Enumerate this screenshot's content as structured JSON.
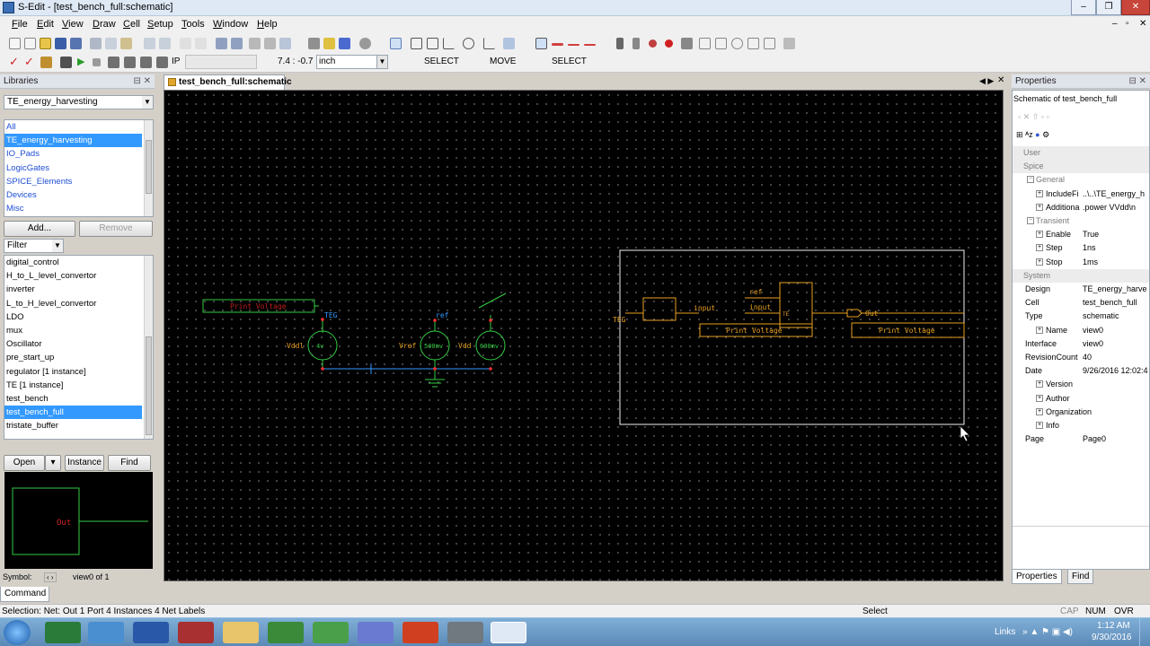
{
  "window": {
    "title": "S-Edit - [test_bench_full:schematic]"
  },
  "menu": [
    "File",
    "Edit",
    "View",
    "Draw",
    "Cell",
    "Setup",
    "Tools",
    "Window",
    "Help"
  ],
  "menu_underline": [
    "F",
    "E",
    "V",
    "D",
    "C",
    "S",
    "T",
    "W",
    "H"
  ],
  "toolbar": {
    "coord": "7.4 : -0.7",
    "unit": "inch",
    "mode_buttons": [
      "SELECT",
      "MOVE",
      "SELECT"
    ]
  },
  "libraries": {
    "header": "Libraries",
    "selected_library": "TE_energy_harvesting",
    "library_list": [
      "All",
      "TE_energy_harvesting",
      "IO_Pads",
      "LogicGates",
      "SPICE_Elements",
      "Devices",
      "Misc"
    ],
    "add_label": "Add...",
    "remove_label": "Remove",
    "filter_label": "Filter",
    "cells": [
      "digital_control",
      "H_to_L_level_convertor",
      "inverter",
      "L_to_H_level_convertor",
      "LDO",
      "mux",
      "Oscillator",
      "pre_start_up",
      "regulator [1 instance]",
      "TE [1 instance]",
      "test_bench",
      "test_bench_full",
      "tristate_buffer"
    ],
    "selected_cell": "test_bench_full",
    "open_label": "Open",
    "instance_label": "Instance",
    "find_label": "Find",
    "preview_label": "Out",
    "symbol_label": "Symbol:",
    "view_label": "view0 of 1"
  },
  "document_tab": "test_bench_full:schematic",
  "schematic": {
    "labels": {
      "print_voltage": "Print Voltage",
      "teg": "TEG",
      "ref": "ref",
      "vddl": "Vddl",
      "v4": "4v",
      "vref": "Vref",
      "v500": "500mv",
      "vdd": "Vdd",
      "v600": "600mv",
      "input": "input",
      "out": "Out",
      "te": "TE"
    }
  },
  "properties": {
    "header": "Properties",
    "title": "Schematic of test_bench_full",
    "rows": [
      {
        "key": "User",
        "value": "",
        "type": "cat"
      },
      {
        "key": "Spice",
        "value": "",
        "type": "cat"
      },
      {
        "key": "General",
        "value": "",
        "type": "sub"
      },
      {
        "key": "IncludeFi",
        "value": "..\\..\\TE_energy_h",
        "type": "item"
      },
      {
        "key": "Additiona",
        "value": ".power VVdd\\n",
        "type": "item"
      },
      {
        "key": "Transient",
        "value": "",
        "type": "sub"
      },
      {
        "key": "Enable",
        "value": "True",
        "type": "item"
      },
      {
        "key": "Step",
        "value": "1ns",
        "type": "item"
      },
      {
        "key": "Stop",
        "value": "1ms",
        "type": "item"
      },
      {
        "key": "System",
        "value": "",
        "type": "cat"
      },
      {
        "key": "Design",
        "value": "TE_energy_harve",
        "type": "plain"
      },
      {
        "key": "Cell",
        "value": "test_bench_full",
        "type": "plain"
      },
      {
        "key": "Type",
        "value": "schematic",
        "type": "plain"
      },
      {
        "key": "Name",
        "value": "view0",
        "type": "item"
      },
      {
        "key": "Interface",
        "value": "view0",
        "type": "plain"
      },
      {
        "key": "RevisionCount",
        "value": "40",
        "type": "plain"
      },
      {
        "key": "Date",
        "value": "9/26/2016 12:02:4",
        "type": "plain"
      },
      {
        "key": "Version",
        "value": "",
        "type": "item"
      },
      {
        "key": "Author",
        "value": "",
        "type": "item"
      },
      {
        "key": "Organization",
        "value": "",
        "type": "item"
      },
      {
        "key": "Info",
        "value": "",
        "type": "item"
      },
      {
        "key": "Page",
        "value": "Page0",
        "type": "plain"
      }
    ],
    "tabs": [
      "Properties",
      "Find"
    ]
  },
  "command_tab": "Command",
  "status": {
    "selection": "Selection:  Net: Out 1 Port 4 Instances 4 Net Labels",
    "mode": "Select",
    "caps": "CAP",
    "num": "NUM",
    "ovr": "OVR"
  },
  "taskbar": {
    "links": "Links",
    "time": "1:12 AM",
    "date": "9/30/2016"
  },
  "colors": {
    "canvas": "#000000",
    "wire_green": "#33cc44",
    "wire_orange": "#e8a020",
    "selected_blue": "#3399ff",
    "port_red": "#ff3030",
    "selection_box": "#ffffff"
  }
}
